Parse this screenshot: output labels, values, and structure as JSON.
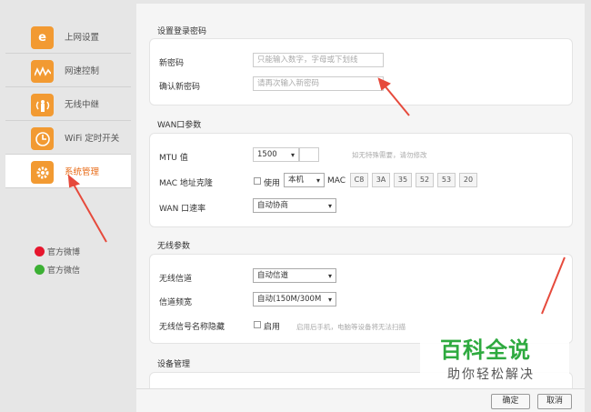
{
  "sidebar": {
    "items": [
      {
        "label": "上网设置",
        "icon": "ie-icon",
        "active": false
      },
      {
        "label": "网速控制",
        "icon": "speed-wave-icon",
        "active": false
      },
      {
        "label": "无线中继",
        "icon": "wireless-relay-icon",
        "active": false
      },
      {
        "label": "WiFi 定时开关",
        "icon": "clock-icon",
        "active": false
      },
      {
        "label": "系统管理",
        "icon": "gear-icon",
        "active": true
      }
    ],
    "weibo": "官方微博",
    "wechat": "官方微信"
  },
  "login_password": {
    "title": "设置登录密码",
    "new_label": "新密码",
    "new_placeholder": "只能输入数字，字母或下划线",
    "confirm_label": "确认新密码",
    "confirm_placeholder": "请再次输入新密码"
  },
  "wan": {
    "title": "WAN口参数",
    "mtu_label": "MTU 值",
    "mtu_value": "1500",
    "mtu_hint": "如无特殊需要，请勿修改",
    "mac_label": "MAC 地址克隆",
    "use_label": "使用",
    "mac_mode": "本机",
    "mac_prefix": "MAC",
    "mac_octets": [
      "C8",
      "3A",
      "35",
      "52",
      "53",
      "20"
    ],
    "rate_label": "WAN 口速率",
    "rate_value": "自动协商"
  },
  "wireless": {
    "title": "无线参数",
    "channel_label": "无线信道",
    "channel_value": "自动信道",
    "bandwidth_label": "信道频宽",
    "bandwidth_value": "自动(150M/300M",
    "hide_label": "无线信号名称隐藏",
    "enable_label": "启用",
    "hide_hint": "启用后手机，电脑等设备将无法扫描"
  },
  "device": {
    "title": "设备管理"
  },
  "buttons": {
    "ok": "确定",
    "cancel": "取消"
  },
  "watermark": {
    "title": "百科全说",
    "subtitle": "助你轻松解决"
  },
  "colors": {
    "accent": "#e86b17",
    "icon_bg": "#f29a32",
    "arrow": "#e64a3c",
    "watermark_green": "#2eaa3f"
  }
}
